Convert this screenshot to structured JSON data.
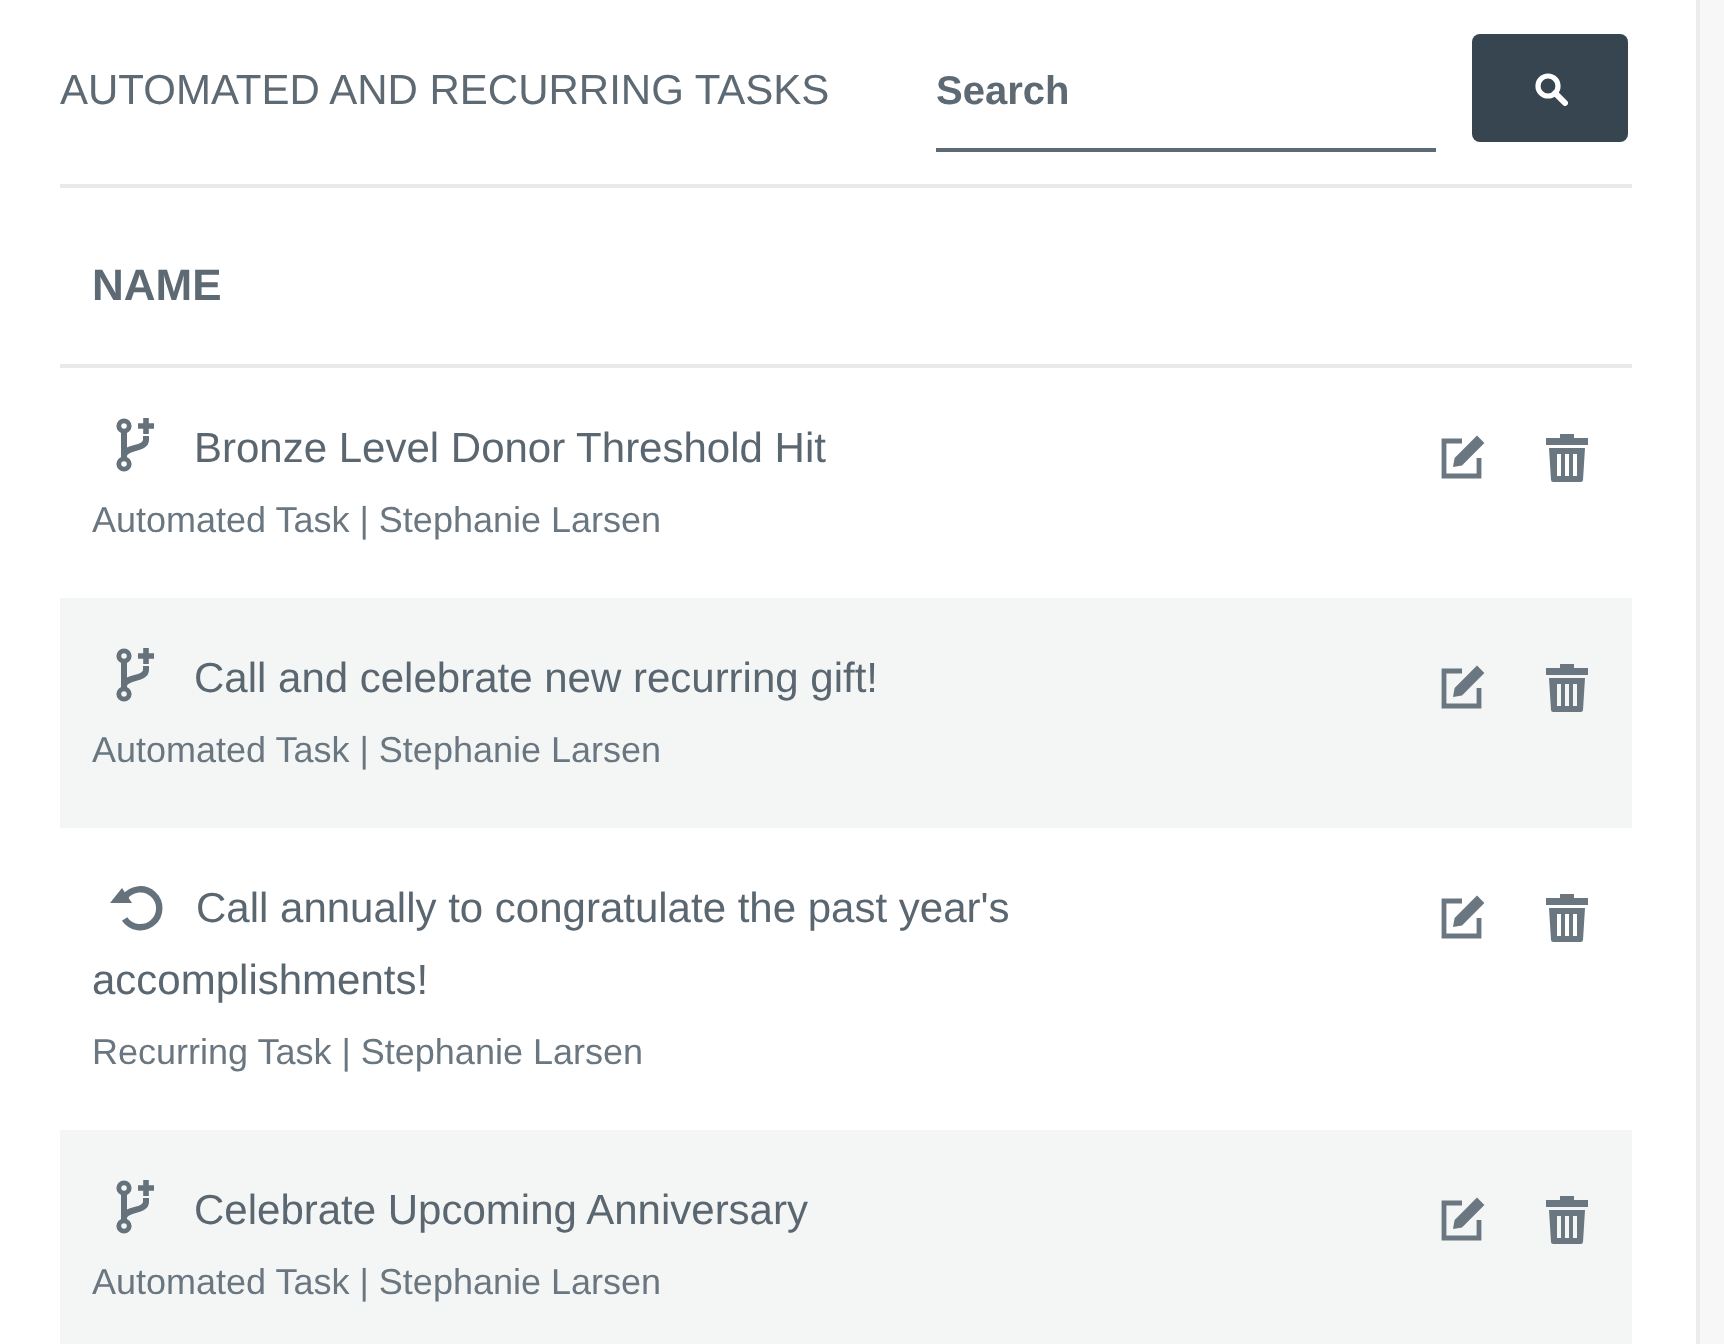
{
  "header": {
    "title": "AUTOMATED AND RECURRING TASKS",
    "search": {
      "placeholder": "Search"
    }
  },
  "table": {
    "columns": [
      "NAME"
    ],
    "rows": [
      {
        "kind": "automated",
        "title": "Bronze Level Donor Threshold Hit",
        "subtitle": "Automated Task | Stephanie Larsen"
      },
      {
        "kind": "automated",
        "title": "Call and celebrate new recurring gift!",
        "subtitle": "Automated Task | Stephanie Larsen"
      },
      {
        "kind": "recurring",
        "title": "Call annually to congratulate the past year's accomplishments!",
        "subtitle": "Recurring Task | Stephanie Larsen"
      },
      {
        "kind": "automated",
        "title": "Celebrate Upcoming Anniversary",
        "subtitle": "Automated Task | Stephanie Larsen"
      }
    ]
  }
}
